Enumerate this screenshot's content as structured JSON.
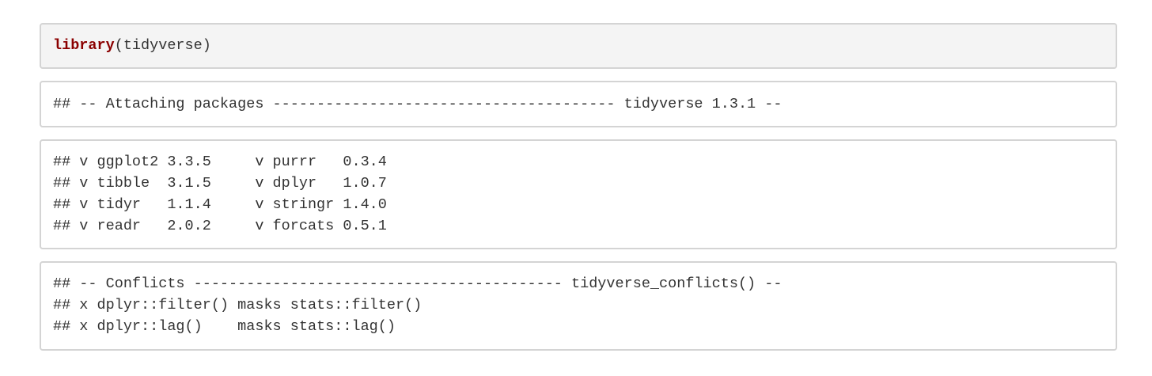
{
  "source_chunk": {
    "function": "library",
    "argument": "(tidyverse)"
  },
  "output_chunks": [
    {
      "lines": [
        "## -- Attaching packages --------------------------------------- tidyverse 1.3.1 --"
      ]
    },
    {
      "lines": [
        "## v ggplot2 3.3.5     v purrr   0.3.4",
        "## v tibble  3.1.5     v dplyr   1.0.7",
        "## v tidyr   1.1.4     v stringr 1.4.0",
        "## v readr   2.0.2     v forcats 0.5.1"
      ]
    },
    {
      "lines": [
        "## -- Conflicts ------------------------------------------ tidyverse_conflicts() --",
        "## x dplyr::filter() masks stats::filter()",
        "## x dplyr::lag()    masks stats::lag()"
      ]
    }
  ],
  "colors": {
    "keyword": "#8b0000",
    "source_background": "#f4f4f4",
    "border": "#d4d4d4",
    "text": "#333333"
  }
}
